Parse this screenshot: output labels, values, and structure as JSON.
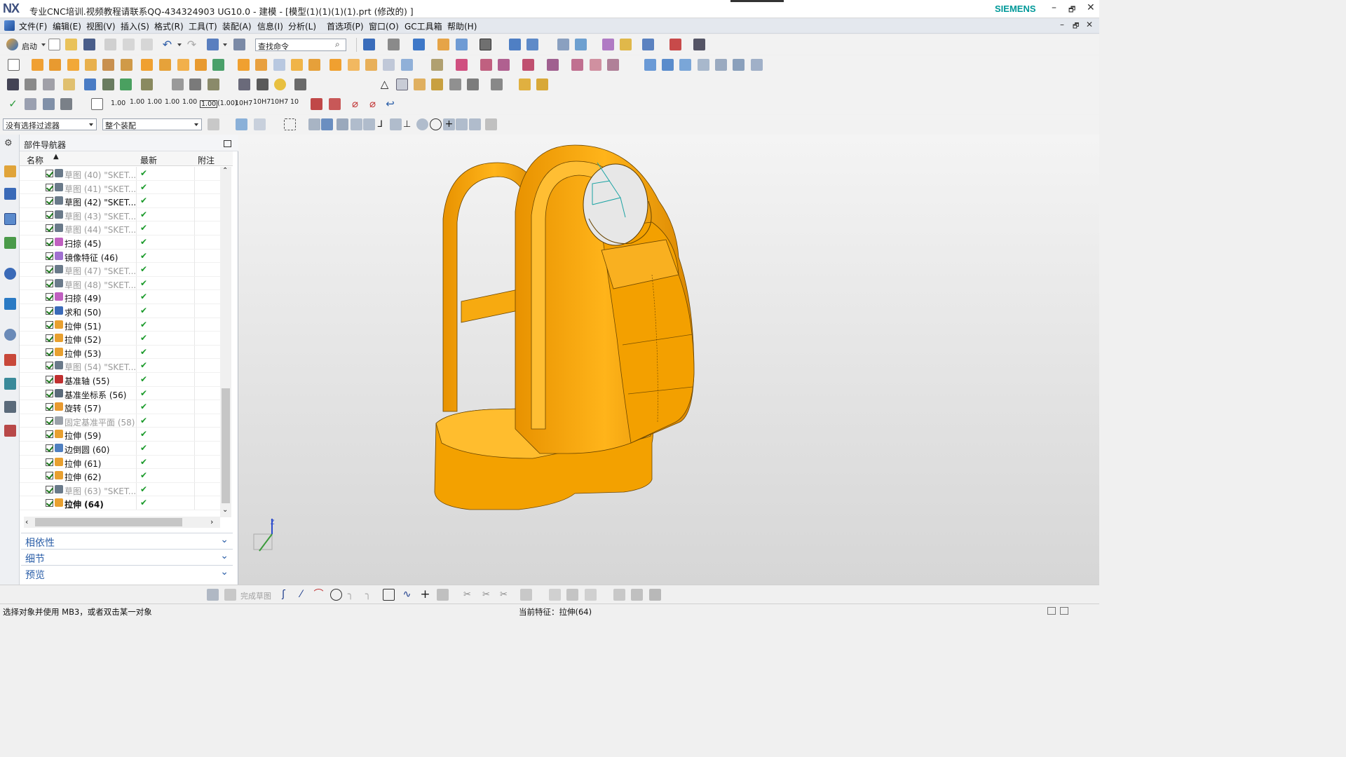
{
  "app": {
    "logo": "NX",
    "window_title": "专业CNC培训.视频教程请联系QQ-434324903 UG10.0 - 建模 - [模型(1)(1)(1)(1).prt  (修改的)  ]",
    "brand": "SIEMENS",
    "window_controls": [
      "–",
      "🗗",
      "✕"
    ]
  },
  "menu": [
    "文件(F)",
    "编辑(E)",
    "视图(V)",
    "插入(S)",
    "格式(R)",
    "工具(T)",
    "装配(A)",
    "信息(I)",
    "分析(L)",
    "首选项(P)",
    "窗口(O)",
    "GC工具箱",
    "帮助(H)"
  ],
  "toolbar": {
    "start_label": "启动",
    "search_placeholder": "查找命令",
    "dimension_labels": [
      "1.00",
      "1.00",
      "1.00",
      "1.00",
      "1.00",
      "1.00",
      "(1.00)",
      "10H7",
      "10H7",
      "10H7",
      "10"
    ]
  },
  "selection": {
    "filter": "没有选择过滤器",
    "scope": "整个装配"
  },
  "navigator": {
    "title": "部件导航器",
    "columns": [
      "名称",
      "最新",
      "附注"
    ],
    "rows": [
      {
        "label": "草图 (40) \"SKET...",
        "dim": true,
        "status": "✔"
      },
      {
        "label": "草图 (41) \"SKET...",
        "dim": true,
        "status": "✔"
      },
      {
        "label": "草图 (42) \"SKET...",
        "dim": false,
        "status": "✔"
      },
      {
        "label": "草图 (43) \"SKET...",
        "dim": true,
        "status": "✔"
      },
      {
        "label": "草图 (44) \"SKET...",
        "dim": true,
        "status": "✔"
      },
      {
        "label": "扫掠 (45)",
        "dim": false,
        "status": "✔"
      },
      {
        "label": "镜像特征 (46)",
        "dim": false,
        "status": "✔"
      },
      {
        "label": "草图 (47) \"SKET...",
        "dim": true,
        "status": "✔"
      },
      {
        "label": "草图 (48) \"SKET...",
        "dim": true,
        "status": "✔"
      },
      {
        "label": "扫掠 (49)",
        "dim": false,
        "status": "✔"
      },
      {
        "label": "求和 (50)",
        "dim": false,
        "status": "✔"
      },
      {
        "label": "拉伸 (51)",
        "dim": false,
        "status": "✔"
      },
      {
        "label": "拉伸 (52)",
        "dim": false,
        "status": "✔"
      },
      {
        "label": "拉伸 (53)",
        "dim": false,
        "status": "✔"
      },
      {
        "label": "草图 (54) \"SKET...",
        "dim": true,
        "status": "✔"
      },
      {
        "label": "基准轴 (55)",
        "dim": false,
        "status": "✔"
      },
      {
        "label": "基准坐标系 (56)",
        "dim": false,
        "status": "✔"
      },
      {
        "label": "旋转 (57)",
        "dim": false,
        "status": "✔"
      },
      {
        "label": "固定基准平面 (58)",
        "dim": true,
        "status": "✔"
      },
      {
        "label": "拉伸 (59)",
        "dim": false,
        "status": "✔"
      },
      {
        "label": "边倒圆 (60)",
        "dim": false,
        "status": "✔"
      },
      {
        "label": "拉伸 (61)",
        "dim": false,
        "status": "✔"
      },
      {
        "label": "拉伸 (62)",
        "dim": false,
        "status": "✔"
      },
      {
        "label": "草图 (63) \"SKET...",
        "dim": true,
        "status": "✔"
      },
      {
        "label": "拉伸 (64)",
        "dim": false,
        "bold": true,
        "status": "✔"
      }
    ],
    "sections": [
      "相依性",
      "细节",
      "预览"
    ]
  },
  "viewport": {
    "axis_label": "Z",
    "model_color": "#f5a300"
  },
  "sketch_bar": {
    "finish_label": "完成草图"
  },
  "status": {
    "prompt": "选择对象并使用 MB3，或者双击某一对象",
    "current_feature": "当前特征：拉伸(64)"
  }
}
